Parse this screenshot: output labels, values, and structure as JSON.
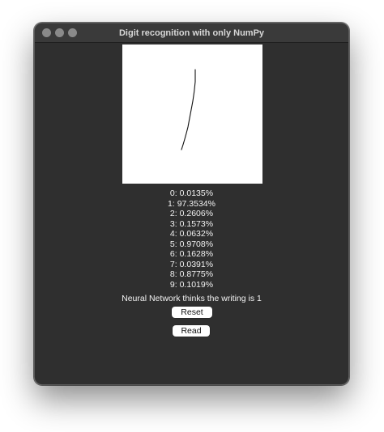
{
  "window": {
    "title": "Digit recognition with only NumPy"
  },
  "canvas": {
    "background": "#ffffff",
    "stroke_color": "#111111"
  },
  "predictions": [
    "0: 0.0135%",
    "1: 97.3534%",
    "2: 0.2606%",
    "3: 0.1573%",
    "4: 0.0632%",
    "5: 0.9708%",
    "6: 0.1628%",
    "7: 0.0391%",
    "8: 0.8775%",
    "9: 0.1019%"
  ],
  "verdict": "Neural Network thinks the writing is 1",
  "buttons": {
    "reset_label": "Reset",
    "read_label": "Read"
  }
}
